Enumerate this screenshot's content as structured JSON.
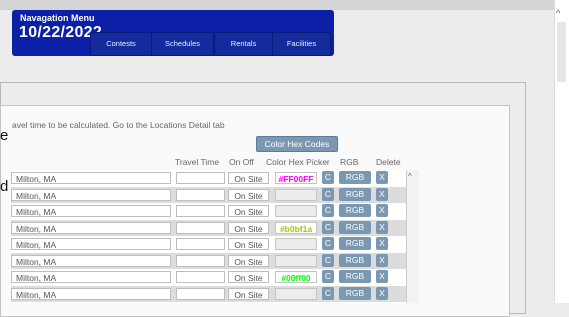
{
  "nav": {
    "title": "Navagation Menu",
    "date": "10/22/2022",
    "buttons": [
      "Contests",
      "Schedules",
      "Rentals",
      "Facilities"
    ]
  },
  "info_text": "avel time to be calculated. Go to the Locations Detail tab",
  "hex_codes_button": "Color Hex Codes",
  "table": {
    "headers": {
      "travel_time": "Travel Time",
      "on_off": "On Off",
      "color_hex_picker": "Color Hex Picker",
      "rgb": "RGB",
      "delete": "Delete"
    },
    "rows": [
      {
        "location": "Milton, MA",
        "on_site": "On Site",
        "hex": "#FF00FF",
        "hex_color": "#ff00ff",
        "c": "C",
        "rgb": "RGB",
        "x": "X"
      },
      {
        "location": "Milton, MA",
        "on_site": "On Site",
        "hex": "",
        "hex_color": "",
        "c": "C",
        "rgb": "RGB",
        "x": "X"
      },
      {
        "location": "Milton, MA",
        "on_site": "On Site",
        "hex": "",
        "hex_color": "",
        "c": "C",
        "rgb": "RGB",
        "x": "X"
      },
      {
        "location": "Milton, MA",
        "on_site": "On Site",
        "hex": "#b0bf1a",
        "hex_color": "#b0bf1a",
        "c": "C",
        "rgb": "RGB",
        "x": "X"
      },
      {
        "location": "Milton, MA",
        "on_site": "On Site",
        "hex": "",
        "hex_color": "",
        "c": "C",
        "rgb": "RGB",
        "x": "X"
      },
      {
        "location": "Milton, MA",
        "on_site": "On Site",
        "hex": "",
        "hex_color": "",
        "c": "C",
        "rgb": "RGB",
        "x": "X"
      },
      {
        "location": "Milton, MA",
        "on_site": "On Site",
        "hex": "#00ff00",
        "hex_color": "#00ff00",
        "c": "C",
        "rgb": "RGB",
        "x": "X"
      },
      {
        "location": "Milton, MA",
        "on_site": "On Site",
        "hex": "",
        "hex_color": "",
        "c": "C",
        "rgb": "RGB",
        "x": "X"
      }
    ]
  },
  "left_fragments": [
    "e",
    "d"
  ],
  "colors": {
    "nav_bg": "#0b20a6",
    "button_bg": "#7a98b2"
  },
  "icons": {
    "scroll_up": "chevron-up-icon"
  }
}
